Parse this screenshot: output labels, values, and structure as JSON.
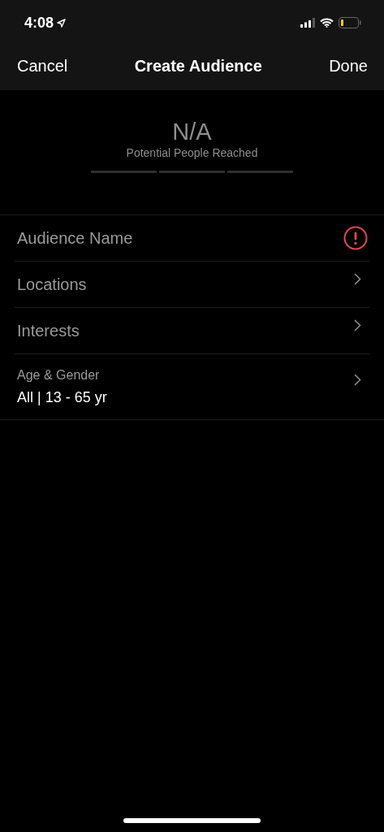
{
  "status_bar": {
    "time": "4:08"
  },
  "nav_bar": {
    "left": "Cancel",
    "title": "Create Audience",
    "right": "Done"
  },
  "reach": {
    "value": "N/A",
    "caption": "Potential People Reached"
  },
  "rows": [
    {
      "kind": "alert",
      "label": "Audience Name"
    },
    {
      "kind": "nav",
      "label": "Locations"
    },
    {
      "kind": "nav",
      "label": "Interests"
    },
    {
      "kind": "detail",
      "label": "Age & Gender",
      "value": "All | 13 - 65 yr"
    }
  ]
}
